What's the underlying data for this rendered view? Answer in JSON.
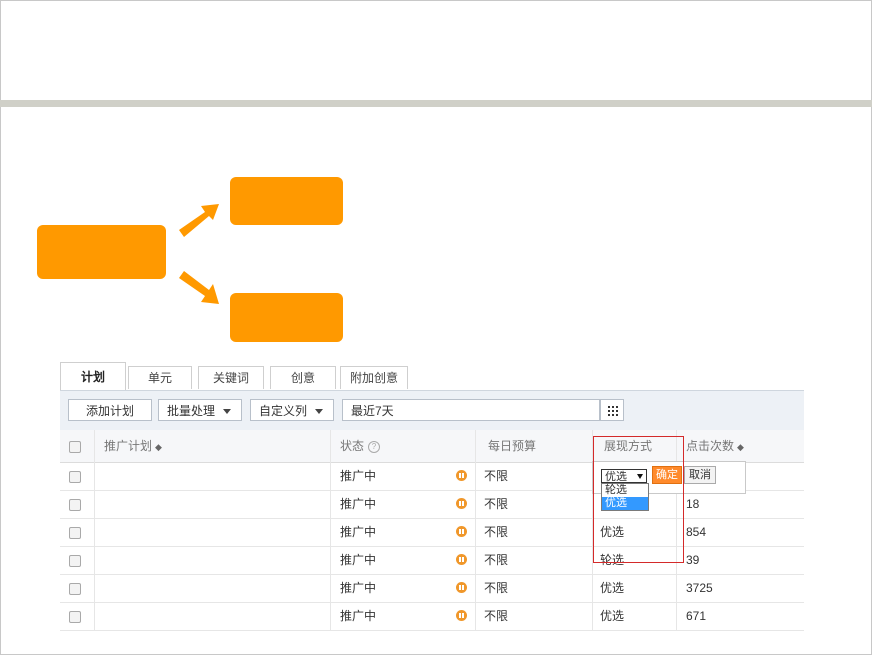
{
  "tabs": [
    "计划",
    "单元",
    "关键词",
    "创意",
    "附加创意"
  ],
  "toolbar": {
    "add_plan": "添加计划",
    "batch": "批量处理",
    "custom_cols": "自定义列",
    "date_range": "最近7天"
  },
  "headers": {
    "plan": "推广计划",
    "status": "状态",
    "budget": "每日预算",
    "display": "展现方式",
    "clicks": "点击次数",
    "sort_icon": "◆",
    "help_icon": "?"
  },
  "rows": [
    {
      "plan": "",
      "status": "推广中",
      "budget": "不限",
      "display": "",
      "clicks": ""
    },
    {
      "plan": "",
      "status": "推广中",
      "budget": "不限",
      "display": "",
      "clicks": "18"
    },
    {
      "plan": "",
      "status": "推广中",
      "budget": "不限",
      "display": "优选",
      "clicks": "854"
    },
    {
      "plan": "",
      "status": "推广中",
      "budget": "不限",
      "display": "轮选",
      "clicks": "39"
    },
    {
      "plan": "",
      "status": "推广中",
      "budget": "不限",
      "display": "优选",
      "clicks": "3725"
    },
    {
      "plan": "",
      "status": "推广中",
      "budget": "不限",
      "display": "优选",
      "clicks": "671"
    }
  ],
  "dropdown": {
    "selected": "优选",
    "options": [
      "轮选",
      "优选"
    ],
    "ok": "确定",
    "cancel": "取消"
  },
  "colors": {
    "accent": "#ff9900",
    "highlight": "#d42a2a"
  }
}
